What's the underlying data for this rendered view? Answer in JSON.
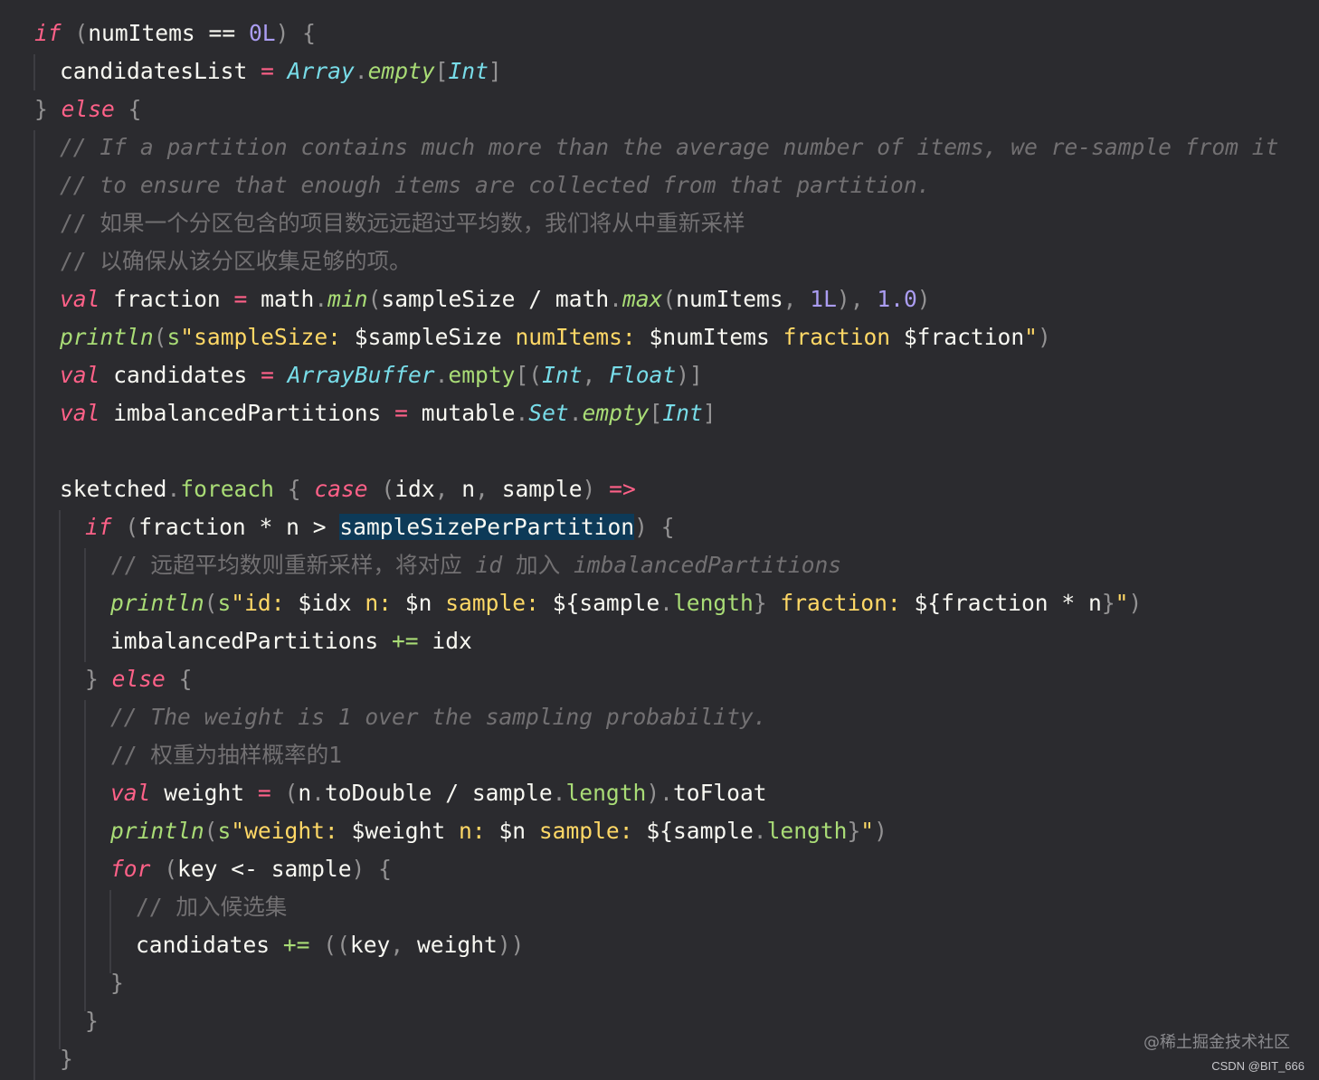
{
  "code": {
    "l1": {
      "a": "if",
      "b": " (",
      "c": "numItems == ",
      "d": "0L",
      "e": ")",
      " f": "",
      "g": " {"
    },
    "l2": {
      "a": "candidatesList ",
      "b": "=",
      "c": " ",
      "d": "Array",
      "e": ".",
      "f": "empty",
      "g": "[",
      "h": "Int",
      "i": "]"
    },
    "l3": {
      "a": "} ",
      "b": "else",
      "c": " {"
    },
    "l4": "// If a partition contains much more than the average number of items, we re-sample from it",
    "l5": "// to ensure that enough items are collected from that partition.",
    "l6": "// 如果一个分区包含的项目数远远超过平均数，我们将从中重新采样",
    "l7": "// 以确保从该分区收集足够的项。",
    "l8": {
      "a": "val",
      "b": " fraction ",
      "c": "=",
      "d": " math",
      "e": ".",
      "f": "min",
      "g": "(",
      "h": "sampleSize / math",
      "i": ".",
      "j": "max",
      "k": "(",
      "l": "numItems",
      ",": ",",
      "m": " ",
      "n": "1L",
      "o": "),",
      "p": " ",
      "q": "1.0",
      "r": ")"
    },
    "l9": {
      "a": "println",
      "b": "(",
      "c": "s",
      "d": "\"sampleSize: ",
      "e": "$sampleSize",
      "f": " numItems: ",
      "g": "$numItems",
      "h": " fraction ",
      "i": "$fraction",
      "j": "\"",
      "k": ")"
    },
    "l10": {
      "a": "val",
      "b": " candidates ",
      "c": "=",
      "d": " ",
      "e": "ArrayBuffer",
      "f": ".",
      "g": "empty",
      "h": "[(",
      "i": "Int",
      "j": ",",
      "k": " ",
      "l": "Float",
      "m": ")]"
    },
    "l11": {
      "a": "val",
      "b": " imbalancedPartitions ",
      "c": "=",
      "d": " mutable",
      "e": ".",
      "f": "Set",
      "g": ".",
      "h": "empty",
      "i": "[",
      "j": "Int",
      "k": "]"
    },
    "l13": {
      "a": "sketched",
      "b": ".",
      "c": "foreach",
      "d": " { ",
      "e": "case",
      "f": " (",
      "g": "idx",
      ",": ",",
      "h": " n",
      ",2": ",",
      "i": " sample",
      "j": ")",
      "k": " ",
      "l": "=>"
    },
    "l14": {
      "a": "if",
      "b": " (",
      "c": "fraction * n > ",
      "d": "sampleSizePerPartition",
      "e": ")",
      "f": " {"
    },
    "l15": {
      "a": "// 远超平均数则重新采样，将对应 ",
      "b": "id",
      "c": " 加入 ",
      "d": "imbalancedPartitions"
    },
    "l16": {
      "a": "println",
      "b": "(",
      "c": "s",
      "d": "\"id: ",
      "e": "$idx",
      "f": " n: ",
      "g": "$n",
      "h": " sample: ",
      "i": "${",
      "j": "sample",
      "k": ".",
      "l": "length",
      "m": "}",
      "n": " fraction: ",
      "o": "${",
      "p": "fraction * n",
      "q": "}",
      "r": "\"",
      "s": ")"
    },
    "l17": {
      "a": "imbalancedPartitions ",
      "b": "+=",
      "c": " idx"
    },
    "l18": {
      "a": "} ",
      "b": "else",
      "c": " {"
    },
    "l19": "// The weight is 1 over the sampling probability.",
    "l20": "// 权重为抽样概率的1",
    "l21": {
      "a": "val",
      "b": " weight ",
      "c": "=",
      "d": " (",
      "e": "n",
      "f": ".",
      "g": "toDouble / sample",
      "h": ".",
      "i": "length",
      "j": ")",
      "k": ".",
      "l": "toFloat"
    },
    "l22": {
      "a": "println",
      "b": "(",
      "c": "s",
      "d": "\"weight: ",
      "e": "$weight",
      "f": " n: ",
      "g": "$n",
      "h": " sample: ",
      "i": "${",
      "j": "sample",
      "k": ".",
      "l": "length",
      "m": "}",
      "n": "\"",
      "o": ")"
    },
    "l23": {
      "a": "for",
      "b": " (",
      "c": "key <- sample",
      "d": ")",
      "e": " {"
    },
    "l24": "// 加入候选集",
    "l25": {
      "a": "candidates ",
      "b": "+=",
      "c": " ((",
      "d": "key",
      ",": ",",
      "e": " weight",
      "f": "))"
    },
    "l26": "}",
    "l27": "}",
    "l28": "}"
  },
  "watermark": {
    "site": "@稀土掘金技术社区",
    "author": "CSDN @BIT_666"
  }
}
